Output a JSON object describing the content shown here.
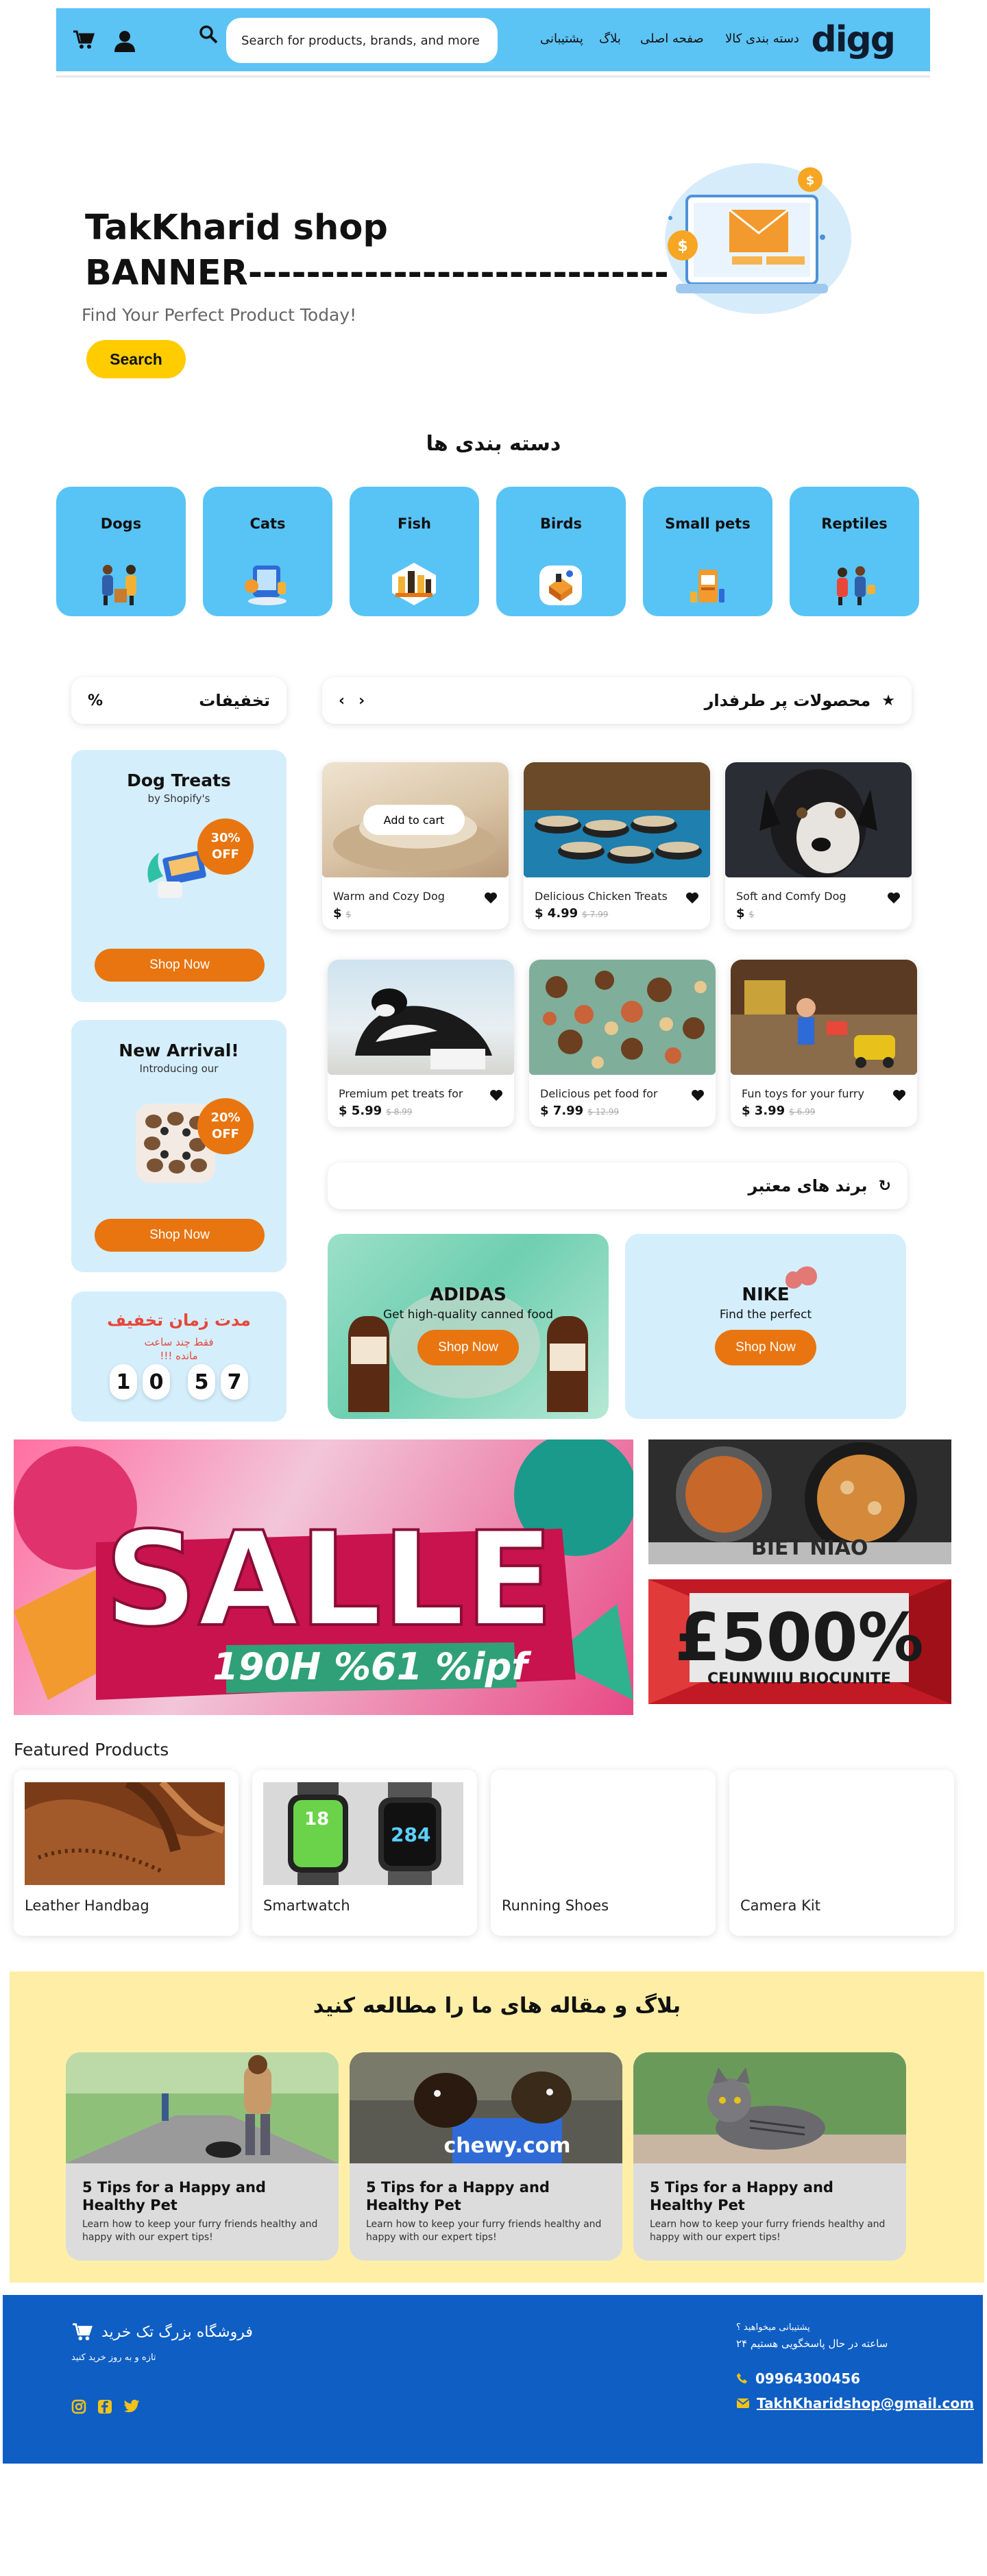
{
  "header": {
    "logo": "digg",
    "nav": [
      "دسته بندی کالا",
      "صفحه اصلی",
      "بلاگ",
      "پشتیبانی"
    ],
    "search_placeholder": "Search for products, brands, and more",
    "icons": [
      "search-icon",
      "cart-icon",
      "user-icon"
    ]
  },
  "hero": {
    "title": "TakKharid shop\nBANNER-----------------------------",
    "subtitle": "Find Your Perfect Product Today!",
    "button": "Search"
  },
  "categories": {
    "title": "دسته بندی ها",
    "items": [
      "Dogs",
      "Cats",
      "Fish",
      "Birds",
      "Small pets",
      "Reptiles"
    ]
  },
  "sidebar": {
    "discounts_label": "تخفیفات",
    "promos": [
      {
        "title": "Dog Treats",
        "subtitle": "by Shopify's",
        "badge": "30% OFF",
        "button": "Shop Now"
      },
      {
        "title": "New Arrival!",
        "subtitle": "Introducing our",
        "badge": "20% OFF",
        "button": "Shop Now"
      }
    ],
    "countdown": {
      "title": "مدت زمان تخفیف",
      "subtitle": "فقط چند ساعت مانده !!!",
      "digits": [
        "1",
        "0",
        "5",
        "7"
      ]
    }
  },
  "popular": {
    "title": "محصولات پر طرفدار",
    "add_to_cart": "Add to cart",
    "products": [
      {
        "name": "Warm and Cozy Dog",
        "price": "$",
        "old_price": "$"
      },
      {
        "name": "Delicious Chicken Treats",
        "price": "$ 4.99",
        "old_price": "$ 7.99"
      },
      {
        "name": "Soft and Comfy Dog",
        "price": "$",
        "old_price": "$"
      },
      {
        "name": "Premium pet treats for",
        "price": "$ 5.99",
        "old_price": "$ 8.99"
      },
      {
        "name": "Delicious pet food for",
        "price": "$ 7.99",
        "old_price": "$ 12.99"
      },
      {
        "name": "Fun toys for your furry",
        "price": "$ 3.99",
        "old_price": "$ 6.99"
      }
    ]
  },
  "brands": {
    "title": "برند های معتبر",
    "items": [
      {
        "name": "ADIDAS",
        "subtitle": "Get high-quality canned food",
        "button": "Shop Now"
      },
      {
        "name": "NIKE",
        "subtitle": "Find the perfect",
        "button": "Shop Now"
      }
    ]
  },
  "banners": {
    "sale_text": "SALLE",
    "sale_sub": "190H %61 %ipf",
    "right_top_text": "BIET NIAO",
    "right_bottom_text": "£500%",
    "right_bottom_sub": "CEUNWIIU BIOCUNITE"
  },
  "featured": {
    "title": "Featured Products",
    "items": [
      "Leather Handbag",
      "Smartwatch",
      "Running Shoes",
      "Camera Kit"
    ],
    "watch_readouts": [
      "18",
      "284"
    ]
  },
  "blog": {
    "title": "بلاگ و مقاله های ما را مطالعه کنید",
    "posts": [
      {
        "title": "5 Tips for a Happy and Healthy Pet",
        "text": "Learn how to keep your furry friends healthy and happy with our expert tips!"
      },
      {
        "title": "5 Tips for a Happy and Healthy Pet",
        "text": "Learn how to keep your furry friends healthy and happy with our expert tips!",
        "box_text": "chewy.com"
      },
      {
        "title": "5 Tips for a Happy and Healthy Pet",
        "text": "Learn how to keep your furry friends healthy and happy with our expert tips!"
      }
    ]
  },
  "footer": {
    "brand": "فروشگاه بزرگ تک خرید",
    "tagline": "تازه و به روز خرید کنید",
    "support_title": "پشتیبانی میخواهید ؟",
    "support_hours": "ساعته در حال پاسخگویی هستیم ۲۴",
    "phone": "09964300456",
    "email": "TakhKharidshop@gmail.com",
    "social": [
      "instagram-icon",
      "facebook-icon",
      "twitter-icon"
    ]
  },
  "colors": {
    "header_bg": "#5cc3f5",
    "accent_yellow": "#ffcc00",
    "accent_orange": "#e8750f",
    "blog_bg": "#ffefa6",
    "footer_bg": "#0e5ec4",
    "countdown_red": "#e8473a"
  }
}
